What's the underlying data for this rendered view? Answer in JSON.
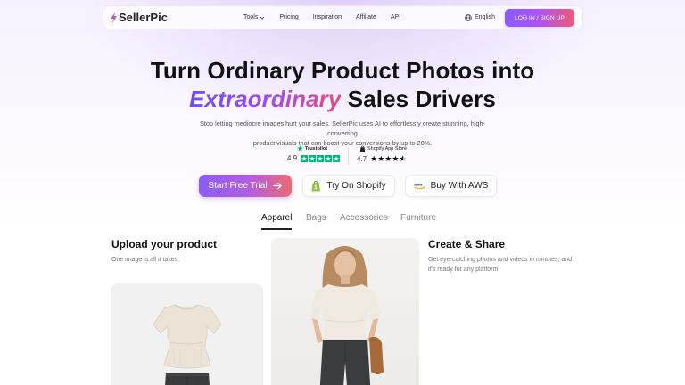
{
  "nav": {
    "logo": "SellerPic",
    "links": [
      "Tools",
      "Pricing",
      "Inspiration",
      "Affiliate",
      "API"
    ],
    "language": "English",
    "login": "LOG IN / SIGN UP"
  },
  "hero": {
    "title_line1": "Turn Ordinary Product Photos into",
    "title_highlight": "Extraordinary",
    "title_line2_rest": " Sales Drivers",
    "subtitle_line1": "Stop letting mediocre images hurt your sales. SellerPic uses AI to effortlessly create stunning, high-converting",
    "subtitle_line2": "product visuals that can boost your conversions by up to 20%."
  },
  "ratings": {
    "trustpilot": {
      "brand": "Trustpilot",
      "score": "4.9"
    },
    "shopify": {
      "brand": "Shopify App Store",
      "score": "4.7"
    }
  },
  "cta": {
    "primary": "Start Free Trial",
    "shopify": "Try On Shopify",
    "aws": "Buy With AWS"
  },
  "tabs": [
    "Apparel",
    "Bags",
    "Accessories",
    "Furniture"
  ],
  "sections": {
    "upload": {
      "title": "Upload your product",
      "text": "One image is all it takes."
    },
    "create": {
      "title": "Create & Share",
      "text_line1": "Get eye-catching photos and videos in minutes, and",
      "text_line2": "it's ready for any platform!"
    }
  },
  "icons": {
    "logo": "bolt-logo-icon",
    "chevron": "chevron-down-icon",
    "globe": "globe-icon",
    "arrow": "arrow-right-icon",
    "shopify": "shopify-bag-icon",
    "aws": "aws-logo-icon",
    "trustpilot": "trustpilot-star-icon"
  },
  "colors": {
    "accent_purple": "#8b5cf6",
    "accent_pink": "#ec5b7a",
    "trustpilot_green": "#00b67a",
    "shopify_green": "#95bf47"
  }
}
